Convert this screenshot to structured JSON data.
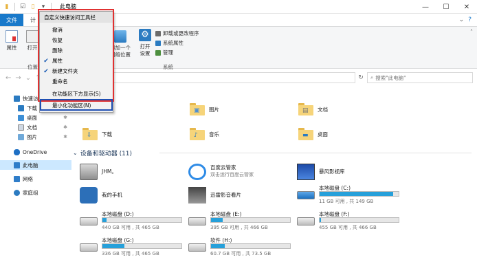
{
  "window": {
    "title": "此电脑",
    "controls": [
      "—",
      "☐",
      "✕"
    ]
  },
  "ribbon_tabs": {
    "file": "文件",
    "computer": "计"
  },
  "ribbon": {
    "properties": "属性",
    "open": "打开",
    "location_group": "位置",
    "add_network_location_line1": "添加一个",
    "add_network_location_line2": "网络位置",
    "open_settings_line1": "打开",
    "open_settings_line2": "设置",
    "uninstall": "卸载或更改程序",
    "system_properties": "系统属性",
    "manage": "管理",
    "system_group": "系统"
  },
  "search": {
    "placeholder": "搜索\"此电脑\""
  },
  "quick_access_menu": {
    "title": "自定义快速访问工具栏",
    "items": [
      {
        "label": "撤消",
        "checked": false
      },
      {
        "label": "恢复",
        "checked": false
      },
      {
        "label": "删除",
        "checked": false
      },
      {
        "label": "属性",
        "checked": true
      },
      {
        "label": "新建文件夹",
        "checked": true
      },
      {
        "label": "重命名",
        "checked": false
      },
      {
        "label": "在功能区下方显示(S)",
        "checked": false
      },
      {
        "label": "最小化功能区(N)",
        "checked": false
      }
    ]
  },
  "nav_pane": {
    "quick_access": "快速访问",
    "downloads": "下载",
    "desktop": "桌面",
    "documents": "文档",
    "pictures": "图片",
    "onedrive": "OneDrive",
    "this_pc": "此电脑",
    "network": "网络",
    "homegroup": "家庭组"
  },
  "folders": {
    "pictures": "图片",
    "documents": "文档",
    "downloads": "下载",
    "music": "音乐",
    "desktop": "桌面"
  },
  "devices_section": "设备和驱动器 (11)",
  "devices": {
    "jhm": "JHM。",
    "baidu": "百度云管家",
    "baidu_sub": "双击运行百度云管家",
    "storm": "暴风影视库",
    "phone": "我的手机",
    "xunlei": "迅雷影音看片",
    "c_name": "本地磁盘 (C:)",
    "c_free": "11 GB 可用 , 共 149 GB",
    "c_used": 0.93,
    "d_name": "本地磁盘 (D:)",
    "d_free": "440 GB 可用 , 共 465 GB",
    "d_used": 0.05,
    "e_name": "本地磁盘 (E:)",
    "e_free": "395 GB 可用 , 共 466 GB",
    "e_used": 0.15,
    "f_name": "本地磁盘 (F:)",
    "f_free": "455 GB 可用 , 共 466 GB",
    "f_used": 0.02,
    "g_name": "本地磁盘 (G:)",
    "g_free": "336 GB 可用 , 共 465 GB",
    "g_used": 0.28,
    "h_name": "软件 (H:)",
    "h_free": "60.7 GB 可用 , 共 73.5 GB",
    "h_used": 0.17
  }
}
